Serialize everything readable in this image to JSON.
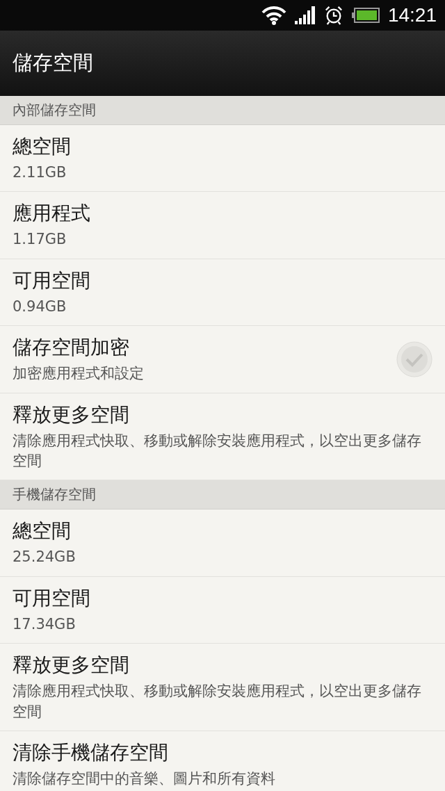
{
  "status_bar": {
    "time": "14:21"
  },
  "title_bar": {
    "title": "儲存空間"
  },
  "sections": [
    {
      "header": "內部儲存空間",
      "items": [
        {
          "kind": "info",
          "title": "總空間",
          "subtitle": "2.11GB"
        },
        {
          "kind": "info",
          "title": "應用程式",
          "subtitle": "1.17GB"
        },
        {
          "kind": "info",
          "title": "可用空間",
          "subtitle": "0.94GB"
        },
        {
          "kind": "checkbox",
          "title": "儲存空間加密",
          "subtitle": "加密應用程式和設定",
          "checked": false
        },
        {
          "kind": "info",
          "title": "釋放更多空間",
          "subtitle": "清除應用程式快取、移動或解除安裝應用程式，以空出更多儲存空間"
        }
      ]
    },
    {
      "header": "手機儲存空間",
      "items": [
        {
          "kind": "info",
          "title": "總空間",
          "subtitle": "25.24GB"
        },
        {
          "kind": "info",
          "title": "可用空間",
          "subtitle": "17.34GB"
        },
        {
          "kind": "info",
          "title": "釋放更多空間",
          "subtitle": "清除應用程式快取、移動或解除安裝應用程式，以空出更多儲存空間"
        },
        {
          "kind": "info",
          "title": "清除手機儲存空間",
          "subtitle": "清除儲存空間中的音樂、圖片和所有資料"
        }
      ]
    }
  ]
}
